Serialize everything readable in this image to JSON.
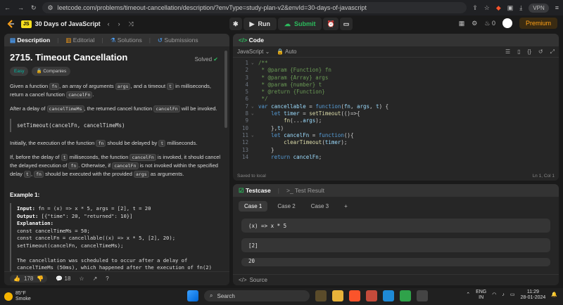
{
  "browser": {
    "url": "leetcode.com/problems/timeout-cancellation/description/?envType=study-plan-v2&envId=30-days-of-javascript",
    "vpn_label": "VPN"
  },
  "topbar": {
    "plan_badge": "JS",
    "plan_title": "30 Days of JavaScript",
    "run_label": "Run",
    "submit_label": "Submit",
    "streak_count": "0",
    "premium_label": "Premium"
  },
  "left_panel": {
    "tabs": [
      "Description",
      "Editorial",
      "Solutions",
      "Submissions"
    ],
    "title": "2715. Timeout Cancellation",
    "status": "Solved",
    "difficulty": "Easy",
    "companies_label": "Companies",
    "intro": {
      "t1": "Given a function",
      "c1": "fn",
      "t2": ", an array of arguments",
      "c2": "args",
      "t3": ", and a timeout",
      "c3": "t",
      "t4": "in milliseconds, return a cancel function",
      "c4": "cancelFn",
      "t5": "."
    },
    "after": {
      "t1": "After a delay of",
      "c1": "cancelTimeMs",
      "t2": ", the returned cancel function",
      "c2": "cancelFn",
      "t3": "will be invoked."
    },
    "call_code": "setTimeout(cancelFn, cancelTimeMs)",
    "initially": {
      "t1": "Initially, the execution of the function",
      "c1": "fn",
      "t2": "should be delayed by",
      "c2": "t",
      "t3": "milliseconds."
    },
    "ifbefore": {
      "t1": "If, before the delay of",
      "c1": "t",
      "t2": "milliseconds, the function",
      "c2": "cancelFn",
      "t3": "is invoked, it should cancel the delayed execution of",
      "c3": "fn",
      "t4": ". Otherwise, if",
      "c4": "cancelFn",
      "t5": "is not invoked within the specified delay",
      "c5": "t",
      "t6": ",",
      "c6": "fn",
      "t7": "should be executed with the provided",
      "c7": "args",
      "t8": "as arguments."
    },
    "example_title": "Example 1:",
    "example": {
      "input_label": "Input:",
      "input_value": " fn = (x) => x * 5, args = [2], t = 20",
      "output_label": "Output:",
      "output_value": " [{\"time\": 20, \"returned\": 10}]",
      "explanation_label": "Explanation:",
      "lines": [
        "const cancelTimeMs = 50;",
        "const cancelFn = cancellable((x) => x * 5, [2], 20);",
        "setTimeout(cancelFn, cancelTimeMs);",
        "",
        "The cancellation was scheduled to occur after a delay of",
        "cancelTimeMs (50ms), which happened after the execution of fn(2)"
      ]
    },
    "footer": {
      "likes": "178",
      "comments": "18"
    }
  },
  "code_panel": {
    "title": "Code",
    "language": "JavaScript",
    "mode": "Auto",
    "saved": "Saved to local",
    "cursor": "Ln 1, Col 1"
  },
  "test_panel": {
    "tab_testcase": "Testcase",
    "tab_result": "Test Result",
    "cases": [
      "Case 1",
      "Case 2",
      "Case 3"
    ],
    "add_symbol": "+",
    "inputs": [
      "(x) => x * 5",
      "[2]",
      "20"
    ],
    "source_label": "Source"
  },
  "taskbar": {
    "temp": "85°F",
    "weather": "Smoke",
    "search_placeholder": "Search",
    "lang": "ENG",
    "region": "IN",
    "time": "11:29",
    "date": "28-01-2024"
  },
  "colors": {
    "accent_orange": "#ffa116",
    "easy_teal": "#00b8a3",
    "submit_green": "#2cbb5d"
  }
}
